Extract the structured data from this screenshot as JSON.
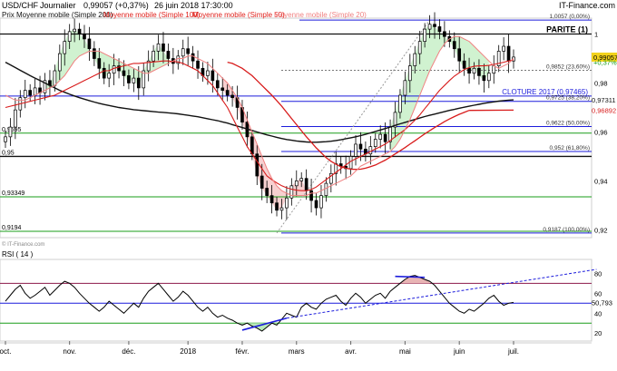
{
  "header": {
    "symbol": "USD/CHF",
    "period": "Journalier",
    "quote": "0,99057 (+0,37%)",
    "date": "26 juin 2018 17:30:00",
    "brand": "IT-Finance.com"
  },
  "watermark": "© IT-Finance.com",
  "legend": [
    {
      "label": "Prix Moyenne mobile (Simple 200)",
      "color": "#111111"
    },
    {
      "label": "Moyenne mobile (Simple 100)",
      "color": "#e0201b"
    },
    {
      "label": "Moyenne mobile (Simple 50)",
      "color": "#e0201b"
    },
    {
      "label": "Moyenne mobile (Simple 20)",
      "color": "#f08080"
    }
  ],
  "colors": {
    "green": "#1a9e1a",
    "blue": "#1c1cdc",
    "red": "#d81b1b",
    "black": "#111111",
    "bull_fill": "#c8f0c8",
    "bear_fill": "#f6c8c8"
  },
  "chart_data": {
    "type": "line",
    "price_panel": {
      "ylim": [
        0.9168,
        1.0065
      ],
      "y_ticks": [
        {
          "value": 1.0,
          "label": "1"
        },
        {
          "value": 0.98,
          "label": "0,98"
        },
        {
          "value": 0.96,
          "label": "0,96"
        },
        {
          "value": 0.94,
          "label": "0,94"
        },
        {
          "value": 0.92,
          "label": "0,92"
        }
      ],
      "price_badges": [
        {
          "value": 0.99116,
          "label": "0,99116",
          "color": "#d81b1b"
        },
        {
          "value": 0.99057,
          "label": "0,99057",
          "color": "#f2d21b"
        },
        {
          "value": 0.9885,
          "label": "+0,37%",
          "color": "#1a9e1a"
        }
      ],
      "horizontal_lines": [
        {
          "value": 1.0,
          "label": "PARITE (1)",
          "color": "#111111"
        },
        {
          "value": 0.97465,
          "label": "CLOTURE 2017 (0,97465)",
          "color": "#1c1cdc"
        },
        {
          "value": 0.9595,
          "label": "0,9595",
          "color": "#1a9e1a"
        },
        {
          "value": 0.95,
          "label": "0,95",
          "color": "#111111"
        },
        {
          "value": 0.93349,
          "label": "0,93349",
          "color": "#1a9e1a"
        },
        {
          "value": 0.9194,
          "label": "0,9194",
          "color": "#1a9e1a"
        }
      ],
      "fib_levels": [
        {
          "value": 1.0057,
          "label": "1,0057 (0,00%)"
        },
        {
          "value": 0.9852,
          "label": "0,9852 (23,60%)"
        },
        {
          "value": 0.9725,
          "label": "0,9725 (38,20%)"
        },
        {
          "value": 0.9622,
          "label": "0,9622 (50,00%)"
        },
        {
          "value": 0.952,
          "label": "0,952 (61,80%)"
        },
        {
          "value": 0.9187,
          "label": "0,9187 (100,00%)"
        }
      ],
      "ma_end_labels": [
        {
          "value": 0.97311,
          "label": "0,97311",
          "color": "#111111"
        },
        {
          "value": 0.96892,
          "label": "0,96892",
          "color": "#d81b1b"
        }
      ],
      "close": [
        0.958,
        0.962,
        0.969,
        0.974,
        0.977,
        0.975,
        0.978,
        0.976,
        0.981,
        0.979,
        0.985,
        0.992,
        0.997,
        1.001,
        1.002,
        1.0,
        0.998,
        0.994,
        0.99,
        0.986,
        0.982,
        0.984,
        0.987,
        0.985,
        0.983,
        0.98,
        0.982,
        0.978,
        0.985,
        0.989,
        0.993,
        0.996,
        0.993,
        0.99,
        0.988,
        0.991,
        0.994,
        0.992,
        0.989,
        0.986,
        0.983,
        0.985,
        0.981,
        0.978,
        0.977,
        0.975,
        0.974,
        0.97,
        0.964,
        0.958,
        0.951,
        0.942,
        0.937,
        0.934,
        0.931,
        0.928,
        0.929,
        0.933,
        0.938,
        0.94,
        0.941,
        0.936,
        0.932,
        0.929,
        0.934,
        0.939,
        0.943,
        0.947,
        0.946,
        0.945,
        0.95,
        0.955,
        0.953,
        0.951,
        0.954,
        0.957,
        0.959,
        0.956,
        0.962,
        0.968,
        0.975,
        0.981,
        0.987,
        0.992,
        0.997,
        1.002,
        1.004,
        1.003,
        1.001,
        0.999,
        0.997,
        0.994,
        0.989,
        0.986,
        0.984,
        0.986,
        0.983,
        0.981,
        0.984,
        0.987,
        0.993,
        0.995,
        0.989,
        0.9906
      ],
      "sma20": [
        0.975,
        0.974,
        0.973,
        0.973,
        0.973,
        0.974,
        0.975,
        0.976,
        0.977,
        0.978,
        0.979,
        0.981,
        0.983,
        0.986,
        0.989,
        0.991,
        0.992,
        0.993,
        0.993,
        0.993,
        0.992,
        0.991,
        0.99,
        0.989,
        0.988,
        0.987,
        0.986,
        0.985,
        0.984,
        0.984,
        0.985,
        0.986,
        0.987,
        0.988,
        0.989,
        0.99,
        0.99,
        0.991,
        0.991,
        0.99,
        0.989,
        0.988,
        0.986,
        0.984,
        0.982,
        0.98,
        0.977,
        0.974,
        0.97,
        0.965,
        0.96,
        0.955,
        0.95,
        0.945,
        0.941,
        0.938,
        0.936,
        0.935,
        0.934,
        0.934,
        0.934,
        0.934,
        0.935,
        0.935,
        0.936,
        0.937,
        0.938,
        0.939,
        0.94,
        0.941,
        0.942,
        0.944,
        0.946,
        0.947,
        0.948,
        0.949,
        0.95,
        0.951,
        0.952,
        0.954,
        0.957,
        0.961,
        0.965,
        0.97,
        0.975,
        0.98,
        0.985,
        0.989,
        0.993,
        0.996,
        0.998,
        0.999,
        0.999,
        0.998,
        0.997,
        0.995,
        0.993,
        0.991,
        0.989,
        0.987,
        0.986,
        0.987,
        0.988,
        0.99
      ],
      "sma50": [
        0.97,
        0.9705,
        0.971,
        0.9715,
        0.972,
        0.9725,
        0.973,
        0.9735,
        0.974,
        0.9745,
        0.975,
        0.976,
        0.977,
        0.978,
        0.979,
        0.98,
        0.981,
        0.982,
        0.983,
        0.984,
        0.985,
        0.985,
        0.986,
        0.9865,
        0.987,
        0.9875,
        0.988,
        0.988,
        0.9882,
        0.9884,
        0.9886,
        0.9888,
        0.989,
        0.989,
        0.9888,
        0.9886,
        0.988,
        0.987,
        0.986,
        0.985,
        0.983,
        0.981,
        0.979,
        0.976,
        0.973,
        0.97,
        0.966,
        0.962,
        0.958,
        0.954,
        0.951,
        0.948,
        0.945,
        0.942,
        0.9405,
        0.9392,
        0.938,
        0.9372,
        0.9366,
        0.9362,
        0.936,
        0.936,
        0.9365,
        0.9375,
        0.939,
        0.9405,
        0.942,
        0.9435,
        0.945,
        0.9465,
        0.948,
        0.949,
        0.95,
        0.951,
        0.952,
        0.953,
        0.954,
        0.955,
        0.9565,
        0.958,
        0.9595,
        0.961,
        0.9628,
        0.9648,
        0.967,
        0.9695,
        0.972,
        0.9745,
        0.977,
        0.979,
        0.981,
        0.9828,
        0.9842,
        0.9855,
        0.9863,
        0.9868,
        0.987,
        0.987,
        0.9872,
        0.9876,
        0.988,
        0.9885,
        0.989,
        0.9895
      ],
      "sma100": [
        null,
        null,
        null,
        null,
        null,
        null,
        null,
        null,
        null,
        null,
        null,
        null,
        null,
        null,
        null,
        null,
        null,
        null,
        null,
        null,
        null,
        null,
        null,
        null,
        null,
        null,
        null,
        null,
        null,
        null,
        null,
        null,
        null,
        null,
        null,
        null,
        null,
        null,
        null,
        null,
        null,
        null,
        null,
        null,
        null,
        0.9885,
        0.988,
        0.987,
        0.986,
        0.9845,
        0.983,
        0.981,
        0.979,
        0.977,
        0.975,
        0.9728,
        0.9705,
        0.968,
        0.9655,
        0.963,
        0.9605,
        0.958,
        0.9558,
        0.9535,
        0.9515,
        0.9495,
        0.948,
        0.9468,
        0.9458,
        0.9452,
        0.9448,
        0.9447,
        0.9448,
        0.9452,
        0.9458,
        0.9465,
        0.9475,
        0.9485,
        0.9497,
        0.951,
        0.9523,
        0.9536,
        0.955,
        0.9564,
        0.9578,
        0.9592,
        0.9605,
        0.9618,
        0.963,
        0.9642,
        0.9653,
        0.9663,
        0.9672,
        0.968,
        0.9688,
        null,
        null,
        null,
        null,
        null,
        null,
        null,
        null,
        null
      ],
      "sma200": [
        0.9885,
        0.9874,
        0.9863,
        0.9852,
        0.9841,
        0.983,
        0.982,
        0.981,
        0.98,
        0.979,
        0.978,
        0.977,
        0.9762,
        0.9754,
        0.9747,
        0.974,
        0.9734,
        0.9728,
        0.9722,
        0.9717,
        0.9712,
        0.9708,
        0.9704,
        0.97,
        0.9697,
        0.9694,
        0.9691,
        0.9689,
        0.9687,
        0.9685,
        0.9683,
        0.9681,
        0.968,
        0.9678,
        0.9676,
        0.9674,
        0.9671,
        0.9668,
        0.9665,
        0.9662,
        0.9658,
        0.9654,
        0.965,
        0.9646,
        0.9641,
        0.9636,
        0.963,
        0.9624,
        0.9618,
        0.9612,
        0.9606,
        0.96,
        0.9594,
        0.9588,
        0.9583,
        0.9578,
        0.9573,
        0.9569,
        0.9566,
        0.9563,
        0.9561,
        0.9559,
        0.9558,
        0.9558,
        0.9559,
        0.956,
        0.9562,
        0.9565,
        0.9568,
        0.9572,
        0.9576,
        0.958,
        0.9585,
        0.959,
        0.9596,
        0.9602,
        0.9608,
        0.9614,
        0.962,
        0.9627,
        0.9633,
        0.9639,
        0.9645,
        0.9651,
        0.9657,
        0.9663,
        0.9668,
        0.9673,
        0.9678,
        0.9683,
        0.9688,
        0.9692,
        0.9697,
        0.9701,
        0.9705,
        0.9709,
        0.9713,
        0.9717,
        0.972,
        0.9723,
        0.9726,
        0.9728,
        0.973,
        0.9731
      ]
    },
    "rsi_panel": {
      "title": "RSI ( 14 )",
      "ylim": [
        12,
        94
      ],
      "y_ticks": [
        {
          "value": 80,
          "label": "80"
        },
        {
          "value": 60,
          "label": "60"
        },
        {
          "value": 40,
          "label": "40"
        },
        {
          "value": 20,
          "label": "20"
        }
      ],
      "levels": [
        {
          "value": 70,
          "color": "#8b1a4a"
        },
        {
          "value": 50,
          "color": "#1c1cdc"
        },
        {
          "value": 30,
          "color": "#1a9e1a"
        }
      ],
      "last_value": {
        "value": 50.793,
        "label": "50,793"
      },
      "values": [
        52,
        58,
        64,
        68,
        60,
        55,
        58,
        62,
        66,
        58,
        63,
        68,
        72,
        70,
        66,
        60,
        55,
        50,
        46,
        42,
        46,
        52,
        48,
        44,
        40,
        45,
        50,
        46,
        55,
        62,
        66,
        70,
        64,
        58,
        52,
        56,
        62,
        58,
        52,
        46,
        42,
        46,
        40,
        36,
        38,
        35,
        33,
        30,
        28,
        30,
        27,
        25,
        22,
        26,
        30,
        28,
        34,
        40,
        38,
        36,
        46,
        50,
        46,
        44,
        50,
        54,
        56,
        58,
        52,
        48,
        55,
        60,
        56,
        50,
        54,
        58,
        60,
        55,
        62,
        66,
        70,
        74,
        77,
        78,
        76,
        74,
        72,
        68,
        62,
        56,
        50,
        46,
        42,
        40,
        44,
        42,
        46,
        50,
        55,
        58,
        52,
        48,
        50,
        50.8
      ],
      "trendlines": [
        {
          "from": [
            48,
            23
          ],
          "to": [
            57,
            35
          ],
          "style": "solid"
        },
        {
          "from": [
            57,
            35
          ],
          "to": [
            104,
            84
          ],
          "style": "dashed"
        },
        {
          "from": [
            79,
            77
          ],
          "to": [
            85,
            76
          ],
          "style": "solid"
        }
      ]
    },
    "x_axis": {
      "ticks": [
        {
          "index": 0,
          "label": "oct."
        },
        {
          "index": 13,
          "label": "nov."
        },
        {
          "index": 25,
          "label": "déc."
        },
        {
          "index": 37,
          "label": "2018"
        },
        {
          "index": 48,
          "label": "févr."
        },
        {
          "index": 59,
          "label": "mars"
        },
        {
          "index": 70,
          "label": "avr."
        },
        {
          "index": 81,
          "label": "mai"
        },
        {
          "index": 92,
          "label": "juin"
        },
        {
          "index": 103,
          "label": "juil."
        }
      ]
    }
  }
}
